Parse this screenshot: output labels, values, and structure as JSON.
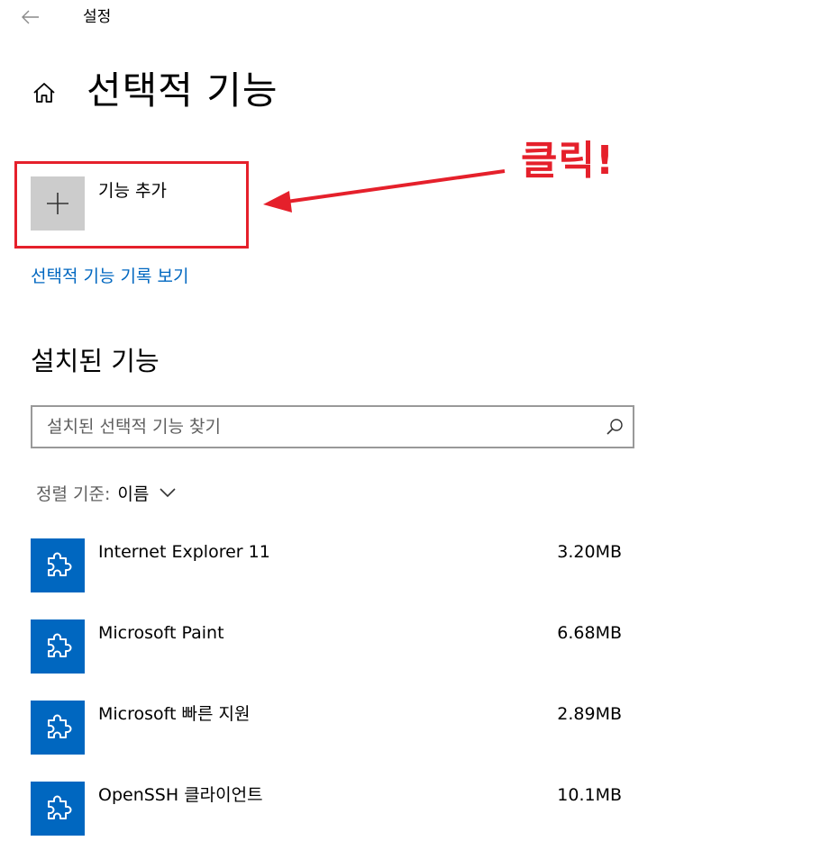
{
  "window": {
    "title": "설정"
  },
  "header": {
    "page_title": "선택적 기능"
  },
  "add_feature": {
    "label": "기능 추가"
  },
  "annotation": {
    "text": "클릭!",
    "color": "#e5202b"
  },
  "history_link": "선택적 기능 기록 보기",
  "installed": {
    "heading": "설치된 기능",
    "search_placeholder": "설치된 선택적 기능 찾기",
    "search_value": "",
    "sort_label": "정렬 기준:",
    "sort_value": "이름",
    "items": [
      {
        "name": "Internet Explorer 11",
        "size": "3.20MB",
        "icon": "puzzle-piece-icon"
      },
      {
        "name": "Microsoft Paint",
        "size": "6.68MB",
        "icon": "puzzle-piece-icon"
      },
      {
        "name": "Microsoft 빠른 지원",
        "size": "2.89MB",
        "icon": "puzzle-piece-icon"
      },
      {
        "name": "OpenSSH 클라이언트",
        "size": "10.1MB",
        "icon": "puzzle-piece-icon"
      }
    ]
  },
  "colors": {
    "accent": "#0067c0",
    "tile_gray": "#cccccc",
    "annotation_red": "#e5202b"
  }
}
